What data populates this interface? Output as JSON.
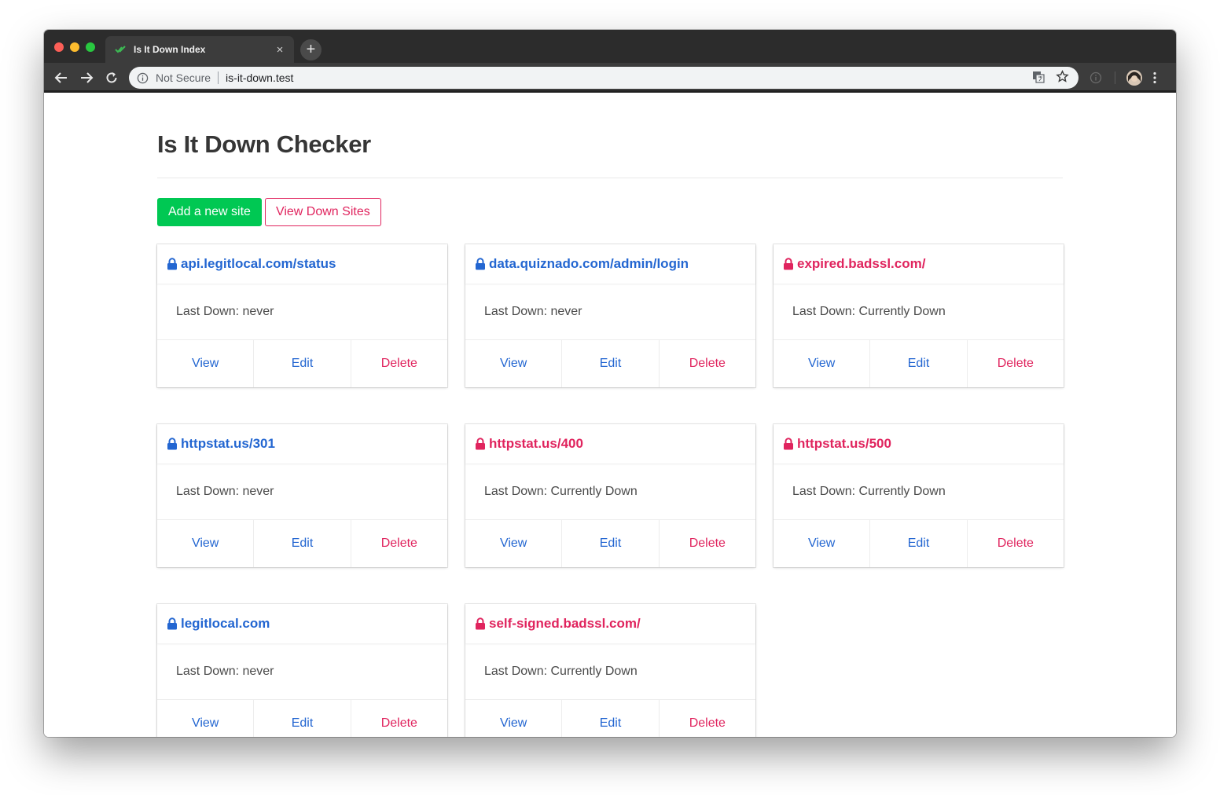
{
  "browser": {
    "tab_title": "Is It Down Index",
    "tab_close": "×",
    "new_tab": "+",
    "security_label": "Not Secure",
    "url": "is-it-down.test"
  },
  "page": {
    "title": "Is It Down Checker",
    "add_button": "Add a new site",
    "view_down_button": "View Down Sites"
  },
  "sites": [
    {
      "url": "api.legitlocal.com/status",
      "last_down": "Last Down: never",
      "status": "up"
    },
    {
      "url": "data.quiznado.com/admin/login",
      "last_down": "Last Down: never",
      "status": "up"
    },
    {
      "url": "expired.badssl.com/",
      "last_down": "Last Down: Currently Down",
      "status": "down"
    },
    {
      "url": "httpstat.us/301",
      "last_down": "Last Down: never",
      "status": "up"
    },
    {
      "url": "httpstat.us/400",
      "last_down": "Last Down: Currently Down",
      "status": "down"
    },
    {
      "url": "httpstat.us/500",
      "last_down": "Last Down: Currently Down",
      "status": "down"
    },
    {
      "url": "legitlocal.com",
      "last_down": "Last Down: never",
      "status": "up"
    },
    {
      "url": "self-signed.badssl.com/",
      "last_down": "Last Down: Currently Down",
      "status": "down"
    }
  ],
  "card_actions": {
    "view": "View",
    "edit": "Edit",
    "delete": "Delete"
  },
  "colors": {
    "up": "#2366d1",
    "down": "#e0245e",
    "add_button": "#00c853"
  }
}
